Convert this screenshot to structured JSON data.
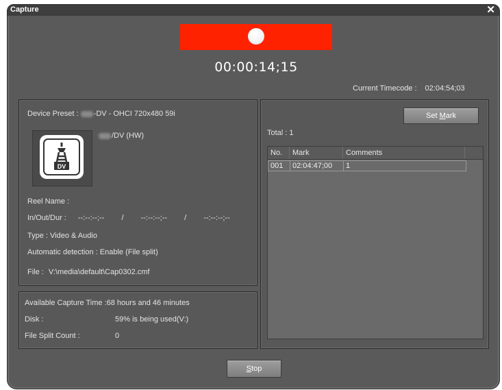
{
  "window": {
    "title": "Capture",
    "close_glyph": "✕"
  },
  "record_indicator": {
    "color": "#ff2200",
    "icon": "record-dot-icon"
  },
  "timecode": "00:00:14;15",
  "current_timecode": {
    "label": "Current Timecode :",
    "value": "02:04:54;03"
  },
  "device": {
    "preset_label": "Device Preset :",
    "preset_value": "-DV - OHCI 720x480 59i",
    "name": "/DV (HW)",
    "icon": "dv-device-icon",
    "icon_text": "DV",
    "reel_label": "Reel Name :",
    "inoutdur_label": "In/Out/Dur :",
    "in_value": "--:--:--;--",
    "sep1": "/",
    "out_value": "--:--:--;--",
    "sep2": "/",
    "dur_value": "--:--:--;--",
    "type_label": "Type :",
    "type_value": "Video & Audio",
    "autodetect_label": "Automatic detection :",
    "autodetect_value": "Enable (File split)",
    "file_label": "File :",
    "file_value": "V:\\media\\default\\Cap0302.cmf"
  },
  "stats": {
    "available_label": "Available Capture Time :",
    "available_value": "68 hours and 46 minutes",
    "disk_label": "Disk :",
    "disk_value": "59% is being used(V:)",
    "split_label": "File Split Count :",
    "split_value": "0"
  },
  "marks": {
    "set_mark_prefix": "Set ",
    "set_mark_underlined": "M",
    "set_mark_suffix": "ark",
    "total_label": "Total : 1",
    "columns": [
      "No.",
      "Mark",
      "Comments"
    ],
    "rows": [
      {
        "no": "001",
        "mark": "02:04:47;00",
        "comment": "1"
      }
    ]
  },
  "stop_button": {
    "underlined": "S",
    "rest": "top"
  }
}
